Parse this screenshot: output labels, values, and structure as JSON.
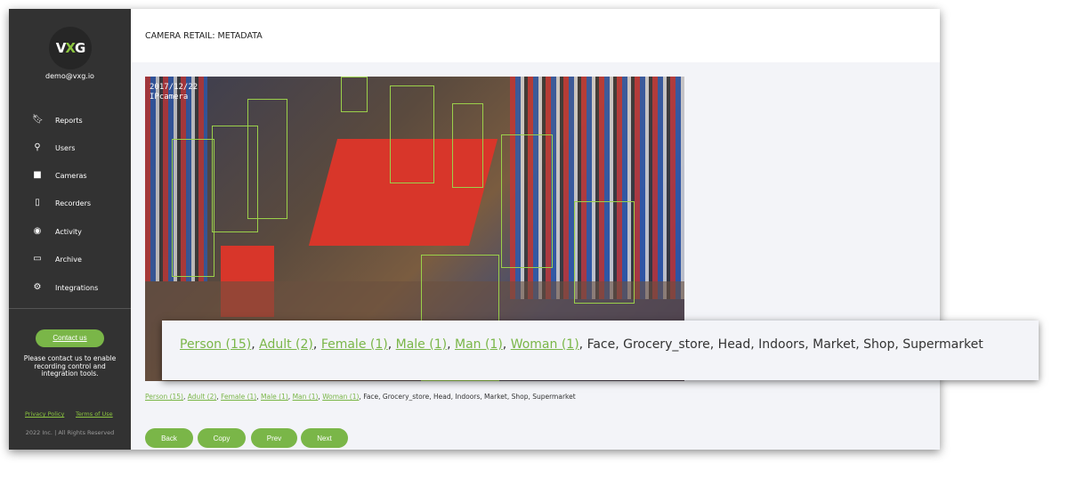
{
  "sidebar": {
    "logo": "VXG",
    "email": "demo@vxg.io",
    "items": [
      {
        "label": "Reports",
        "icon": "bookmark-icon"
      },
      {
        "label": "Users",
        "icon": "user-icon"
      },
      {
        "label": "Cameras",
        "icon": "video-camera-icon"
      },
      {
        "label": "Recorders",
        "icon": "tablet-icon"
      },
      {
        "label": "Activity",
        "icon": "eye-icon"
      },
      {
        "label": "Archive",
        "icon": "folder-icon"
      },
      {
        "label": "Integrations",
        "icon": "gears-icon"
      }
    ],
    "contact_label": "Contact us",
    "note": "Please contact us to enable recording control and integration tools.",
    "privacy": "Privacy Policy",
    "terms": "Terms of Use",
    "copyright": "2022 Inc. | All Rights Reserved"
  },
  "header": {
    "title": "CAMERA RETAIL: METADATA"
  },
  "camera": {
    "timestamp": "2017/12/22",
    "camera_name": "IPcamera"
  },
  "tags": {
    "linked": [
      "Person (15)",
      "Adult (2)",
      "Female (1)",
      "Male (1)",
      "Man (1)",
      "Woman (1)"
    ],
    "plain": "Face, Grocery_store, Head, Indoors, Market, Shop, Supermarket"
  },
  "buttons": {
    "back": "Back",
    "copy": "Copy",
    "prev": "Prev",
    "next": "Next"
  },
  "colors": {
    "accent": "#7ab648",
    "sidebar": "#323232",
    "box": "#9bd04a"
  }
}
